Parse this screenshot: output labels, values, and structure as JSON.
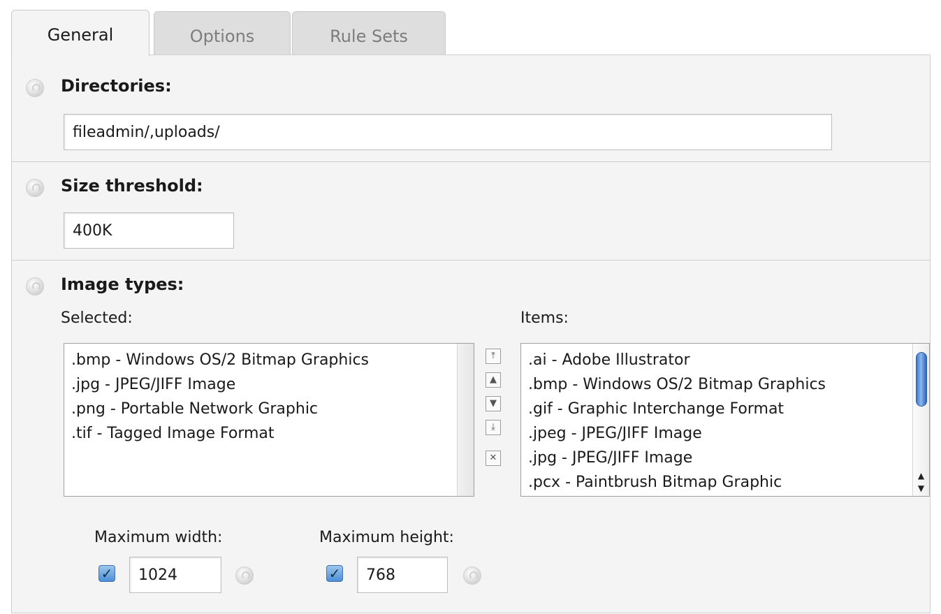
{
  "tabs": [
    {
      "label": "General"
    },
    {
      "label": "Options"
    },
    {
      "label": "Rule Sets"
    }
  ],
  "directories": {
    "label": "Directories:",
    "value": "fileadmin/,uploads/"
  },
  "size_threshold": {
    "label": "Size threshold:",
    "value": "400K"
  },
  "image_types": {
    "label": "Image types:",
    "selected_label": "Selected:",
    "items_label": "Items:",
    "selected": [
      ".bmp - Windows OS/2 Bitmap Graphics",
      ".jpg - JPEG/JIFF Image",
      ".png - Portable Network Graphic",
      ".tif - Tagged Image Format"
    ],
    "items": [
      ".ai - Adobe Illustrator",
      ".bmp - Windows OS/2 Bitmap Graphics",
      ".gif - Graphic Interchange Format",
      ".jpeg - JPEG/JIFF Image",
      ".jpg - JPEG/JIFF Image",
      ".pcx - Paintbrush Bitmap Graphic"
    ],
    "controls": [
      {
        "name": "move-to-top-button",
        "glyph": "⤒"
      },
      {
        "name": "move-up-button",
        "glyph": "▲"
      },
      {
        "name": "move-down-button",
        "glyph": "▼"
      },
      {
        "name": "move-to-bottom-button",
        "glyph": "⤓"
      },
      {
        "name": "remove-button",
        "glyph": "✕"
      }
    ]
  },
  "max_width": {
    "label": "Maximum width:",
    "checked": true,
    "value": "1024"
  },
  "max_height": {
    "label": "Maximum height:",
    "checked": true,
    "value": "768"
  },
  "icons": {
    "checkmark": "✓",
    "scroll_up": "▲",
    "scroll_down": "▼"
  }
}
